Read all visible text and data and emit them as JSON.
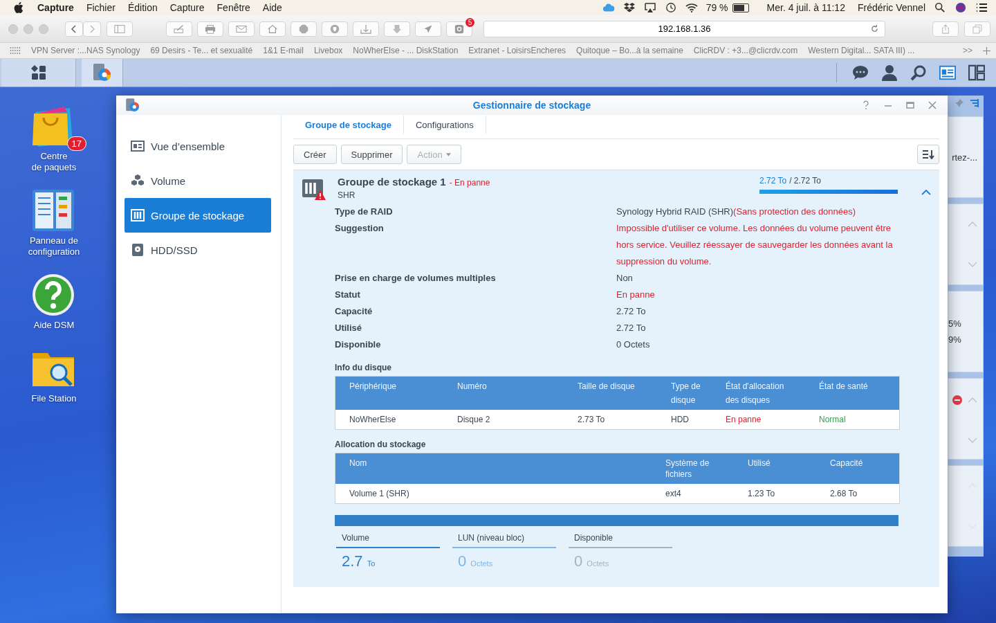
{
  "menubar": {
    "app": "Capture",
    "menus": [
      "Fichier",
      "Édition",
      "Capture",
      "Fenêtre",
      "Aide"
    ],
    "battery": "79 %",
    "clock": "Mer. 4 juil. à  11:12",
    "user": "Frédéric Vennel"
  },
  "browser": {
    "url": "192.168.1.36",
    "badge": "5",
    "bookmarks": [
      "VPN Server :...NAS Synology",
      "69 Desirs - Te... et sexualité",
      "1&1 E-mail",
      "Livebox",
      "NoWherElse - ... DiskStation",
      "Extranet - LoisirsEncheres",
      "Quitoque – Bo...à la semaine",
      "ClicRDV : +3...@clicrdv.com",
      "Western Digital... SATA III) ..."
    ],
    "more": ">>"
  },
  "desktop_icons": [
    {
      "kind": "package",
      "label": "Centre\nde paquets",
      "badge": "17"
    },
    {
      "kind": "config",
      "label": "Panneau de\nconfiguration"
    },
    {
      "kind": "help",
      "label": "Aide DSM"
    },
    {
      "kind": "folder",
      "label": "File Station"
    }
  ],
  "widgets": [
    "rtez-...",
    "5%",
    "9%"
  ],
  "window": {
    "title": "Gestionnaire de stockage",
    "sidebar": [
      {
        "kind": "overview",
        "label": "Vue d’ensemble",
        "selected": false
      },
      {
        "kind": "volume",
        "label": "Volume",
        "selected": false
      },
      {
        "kind": "pool",
        "label": "Groupe de stockage",
        "selected": true
      },
      {
        "kind": "disk",
        "label": "HDD/SSD",
        "selected": false
      }
    ],
    "tabs": [
      {
        "label": "Groupe de stockage",
        "selected": true
      },
      {
        "label": "Configurations",
        "selected": false
      }
    ],
    "buttons": [
      {
        "label": "Créer",
        "disabled": false,
        "caret": false
      },
      {
        "label": "Supprimer",
        "disabled": false,
        "caret": false
      },
      {
        "label": "Action",
        "disabled": true,
        "caret": true
      }
    ],
    "pool": {
      "name": "Groupe de stockage 1",
      "status": "- En panne",
      "type": "SHR",
      "used": "2.72 To",
      "total": "/ 2.72 To",
      "level": 1,
      "expanded": true,
      "details": [
        {
          "label": "Type de RAID",
          "value": "Synology Hybrid RAID (SHR)",
          "note": "(Sans protection des données)",
          "alert": false
        },
        {
          "label": "Suggestion",
          "value": "Impossible d'utiliser ce volume. Les données du volume peuvent être hors service. Veuillez réessayer de sauvegarder les données avant la suppression du volume.",
          "alert": true
        },
        {
          "label": "Prise en charge de volumes multiples",
          "value": "Non",
          "alert": false
        },
        {
          "label": "Statut",
          "value": "En panne",
          "alert": true
        },
        {
          "label": "Capacité",
          "value": "2.72 To",
          "alert": false
        },
        {
          "label": "Utilisé",
          "value": "2.72 To",
          "alert": false
        },
        {
          "label": "Disponible",
          "value": "0 Octets",
          "alert": false
        }
      ],
      "disk_info": {
        "title": "Info du disque",
        "columns": [
          "Périphérique",
          "Numéro",
          "Taille de disque",
          "Type de disque",
          "État d'allocation des disques",
          "État de santé"
        ],
        "rows": [
          [
            {
              "text": "NoWherElse",
              "kind": "plain"
            },
            {
              "text": "Disque 2",
              "kind": "plain"
            },
            {
              "text": "2.73 To",
              "kind": "plain"
            },
            {
              "text": "HDD",
              "kind": "plain"
            },
            {
              "text": "En panne",
              "kind": "error"
            },
            {
              "text": "Normal",
              "kind": "ok"
            }
          ]
        ]
      },
      "allocation": {
        "title": "Allocation du stockage",
        "columns": [
          "Nom",
          "Système de fichiers",
          "Utilisé",
          "Capacité"
        ],
        "rows": [
          [
            "Volume 1 (SHR)",
            "ext4",
            "1.23 To",
            "2.68 To"
          ]
        ]
      },
      "summary": {
        "level": 1,
        "items": [
          {
            "label": "Volume",
            "value": "2.7",
            "unit": "To",
            "color": "#2f7fc9"
          },
          {
            "label": "LUN (niveau bloc)",
            "value": "0",
            "unit": "Octets",
            "color": "#7fb6e6"
          },
          {
            "label": "Disponible",
            "value": "0",
            "unit": "Octets",
            "color": "#a9b2bb"
          }
        ]
      }
    }
  }
}
